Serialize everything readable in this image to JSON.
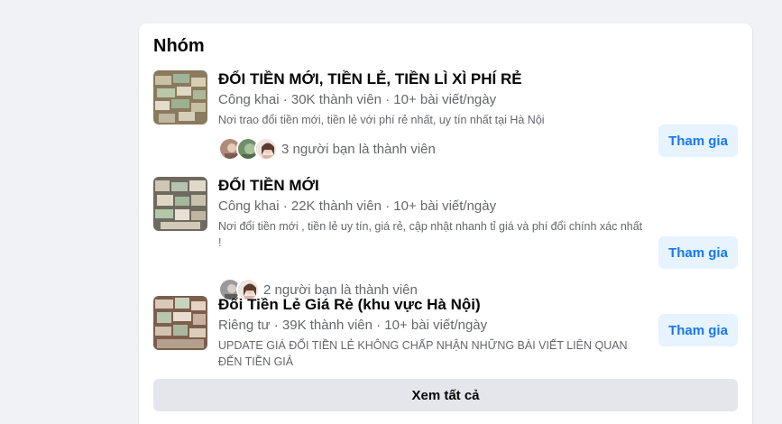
{
  "section": {
    "title": "Nhóm",
    "see_all_label": "Xem tất cả"
  },
  "groups": [
    {
      "name": "ĐỔI TIỀN MỚI, TIỀN LẺ, TIỀN LÌ XÌ PHÍ RẺ",
      "meta": "Công khai · 30K thành viên · 10+ bài viết/ngày",
      "description": "Nơi trao đổi tiền mới, tiền lẻ với phí rẻ nhất, uy tín nhất tại Hà Nội",
      "friends_text": "3 người bạn là thành viên",
      "join_label": "Tham gia"
    },
    {
      "name": "ĐỔI TIỀN MỚI",
      "meta": "Công khai · 22K thành viên · 10+ bài viết/ngày",
      "description": "Nơi đổi tiền mới , tiền lẻ uy tín, giá rẻ, cập nhật nhanh tỉ giá và phí đổi chính xác nhất !",
      "friends_text": "2 người bạn là thành viên",
      "join_label": "Tham gia"
    },
    {
      "name": "Đổi Tiền Lẻ Giá Rẻ (khu vực Hà Nội)",
      "meta": "Riêng tư · 39K thành viên · 10+ bài viết/ngày",
      "description": "UPDATE GIÁ ĐỔI TIỀN LẺ KHÔNG CHẤP NHẬN NHỮNG BÀI VIẾT LIÊN QUAN ĐẾN TIỀN GIẢ",
      "join_label": "Tham gia"
    }
  ],
  "colors": {
    "accent": "#1877f2",
    "join_bg": "#e7f3ff",
    "secondary_text": "#65676b",
    "page_bg": "#f0f2f5"
  }
}
